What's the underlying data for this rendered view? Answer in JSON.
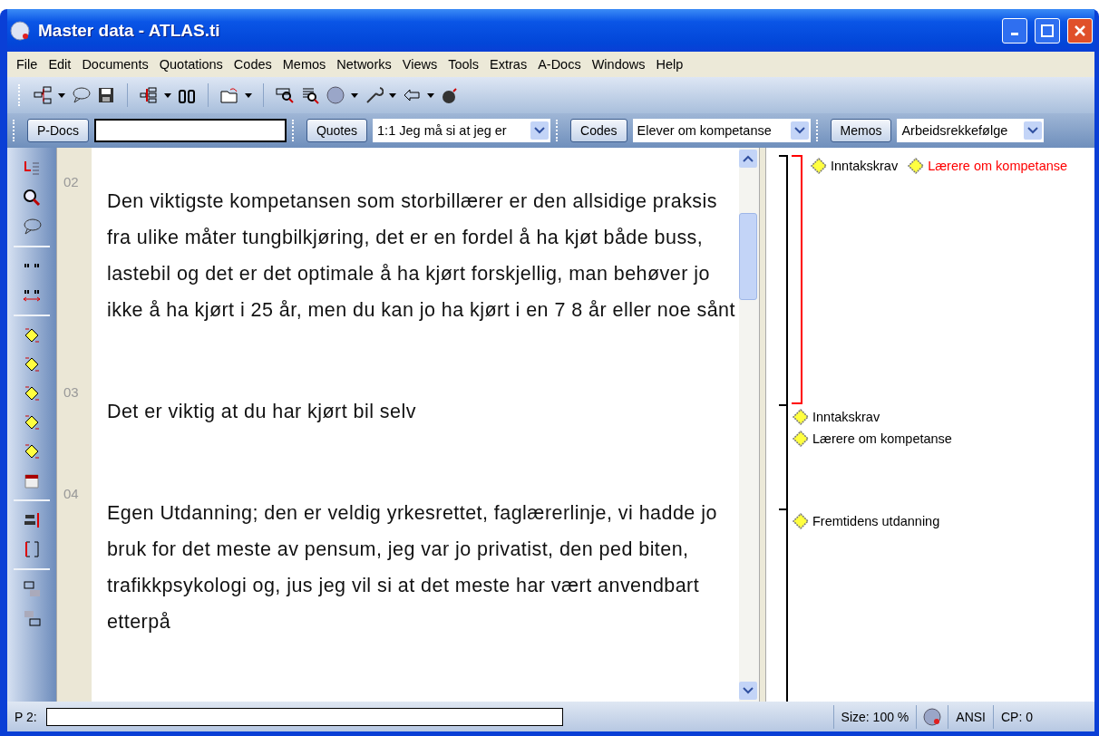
{
  "window": {
    "title": "Master data - ATLAS.ti"
  },
  "menu": [
    "File",
    "Edit",
    "Documents",
    "Quotations",
    "Codes",
    "Memos",
    "Networks",
    "Views",
    "Tools",
    "Extras",
    "A-Docs",
    "Windows",
    "Help"
  ],
  "filter_bar": {
    "pdocs": {
      "button": "P-Docs"
    },
    "quotes": {
      "button": "Quotes",
      "value": "1:1 Jeg må si at jeg er"
    },
    "codes": {
      "button": "Codes",
      "value": "Elever om kompetanse"
    },
    "memos": {
      "button": "Memos",
      "value": "Arbeidsrekkefølge"
    }
  },
  "document": {
    "paragraphs": [
      {
        "number": "02",
        "text": "Den viktigste kompetansen som storbillærer er den allsidige praksis fra ulike måter tungbilkjøring, det er en fordel å ha kjøt både buss, lastebil og det er det optimale å ha kjørt forskjellig, man behøver jo ikke å ha kjørt i 25 år, men du kan jo ha kjørt i en 7 8 år eller noe sånt"
      },
      {
        "number": "03",
        "text": "Det er viktig at du har kjørt bil selv"
      },
      {
        "number": "04",
        "text": "Egen Utdanning; den er veldig yrkesrettet, faglærerlinje, vi hadde jo bruk for det meste av pensum, jeg var jo privatist, den ped biten, trafikkpsykologi og, jus jeg vil si at det meste har vært anvendbart etterpå"
      }
    ]
  },
  "margin": {
    "segments": [
      {
        "selected": true,
        "codes": [
          {
            "label": "Inntakskrav",
            "selected": false
          },
          {
            "label": "Lærere om kompetanse",
            "selected": true
          }
        ]
      },
      {
        "selected": false,
        "codes": [
          {
            "label": "Inntakskrav",
            "selected": false
          },
          {
            "label": "Lærere om kompetanse",
            "selected": false
          }
        ]
      },
      {
        "selected": false,
        "codes": [
          {
            "label": "Fremtidens utdanning",
            "selected": false
          }
        ]
      }
    ]
  },
  "status_bar": {
    "label": "P 2:",
    "size": "Size: 100 %",
    "encoding": "ANSI",
    "cp": "CP: 0"
  }
}
